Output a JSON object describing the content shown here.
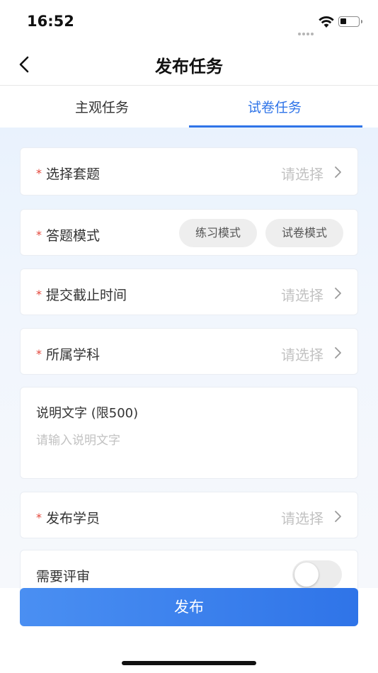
{
  "status_bar": {
    "time": "16:52"
  },
  "nav": {
    "title": "发布任务"
  },
  "tabs": [
    {
      "label": "主观任务",
      "active": false
    },
    {
      "label": "试卷任务",
      "active": true
    }
  ],
  "form": {
    "required_mark": "*",
    "select_set": {
      "label": "选择套题",
      "placeholder": "请选择"
    },
    "answer_mode": {
      "label": "答题模式",
      "options": [
        "练习模式",
        "试卷模式"
      ]
    },
    "deadline": {
      "label": "提交截止时间",
      "placeholder": "请选择"
    },
    "subject": {
      "label": "所属学科",
      "placeholder": "请选择"
    },
    "description": {
      "label": "说明文字 (限500)",
      "placeholder": "请输入说明文字",
      "value": ""
    },
    "students": {
      "label": "发布学员",
      "placeholder": "请选择"
    },
    "review": {
      "label": "需要评审",
      "enabled": false
    }
  },
  "publish_button": {
    "label": "发布"
  },
  "colors": {
    "accent": "#2f74e8",
    "required": "#e4463a",
    "placeholder": "#c2c2c2"
  }
}
